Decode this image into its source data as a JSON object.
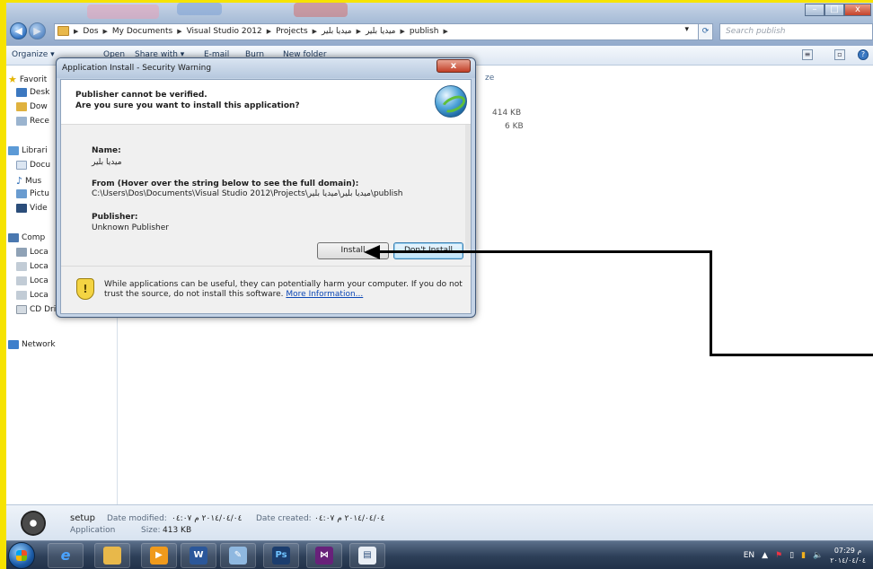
{
  "explorer": {
    "nav": {
      "back_icon": "back-arrow-icon",
      "forward_icon": "forward-arrow-icon",
      "breadcrumb": [
        "Dos",
        "My Documents",
        "Visual Studio 2012",
        "Projects",
        "ميديا بلير",
        "ميديا بلير",
        "publish"
      ],
      "search_placeholder": "Search publish"
    },
    "toolbar": {
      "organize": "Organize ▾",
      "open": "Open",
      "share_with": "Share with ▾",
      "email": "E-mail",
      "burn": "Burn",
      "new_folder": "New folder"
    },
    "sidebar": {
      "favorites": "Favorit",
      "desktop": "Desk",
      "downloads": "Dow",
      "recent": "Rece",
      "libraries": "Librari",
      "documents": "Docu",
      "music": "Mus",
      "pictures": "Pictu",
      "videos": "Vide",
      "computer": "Comp",
      "local1": "Loca",
      "local2": "Loca",
      "local3": "Loca",
      "local4": "Loca",
      "cd": "CD Drive (H:)",
      "network": "Network"
    },
    "files": {
      "size_header": "ze",
      "sizes": [
        "414 KB",
        "6 KB"
      ]
    },
    "details": {
      "name": "setup",
      "type": "Application",
      "modified_label": "Date modified:",
      "modified_value": "٢٠١٤/٠٤/٠٤ م ٠٤:٠٧",
      "size_label": "Size:",
      "size_value": "413 KB",
      "created_label": "Date created:",
      "created_value": "٢٠١٤/٠٤/٠٤ م ٠٤:٠٧"
    }
  },
  "dialog": {
    "title": "Application Install - Security Warning",
    "close": "x",
    "heading1": "Publisher cannot be verified.",
    "heading2": "Are you sure you want to install this application?",
    "name_label": "Name:",
    "name_value": "ميديا بلير",
    "from_label": "From (Hover over the string below to see the full domain):",
    "from_value": "C:\\Users\\Dos\\Documents\\Visual Studio 2012\\Projects\\ميديا بلير\\ميديا بلير\\publish",
    "publisher_label": "Publisher:",
    "publisher_value": "Unknown Publisher",
    "install_button": "Install",
    "dont_install_button": "Don't Install",
    "warning_text": "While applications can be useful, they can potentially harm your computer. If you do not trust the source, do not install this software.",
    "more_info": "More Information..."
  },
  "taskbar": {
    "apps": [
      "ie-icon",
      "explorer-icon",
      "media-player-icon",
      "word-icon",
      "paint-icon",
      "photoshop-icon",
      "visual-studio-icon",
      "app-icon"
    ],
    "ps_label": "Ps",
    "language": "EN",
    "time": "07:29 م",
    "date": "٢٠١٤/٠٤/٠٤"
  },
  "colors": {
    "frame": "#f6e300",
    "taskbar": "#2d3f58",
    "link": "#0a46b5"
  }
}
